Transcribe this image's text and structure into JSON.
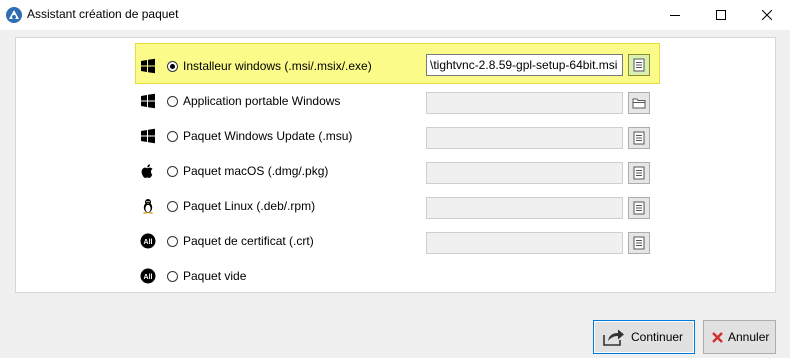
{
  "window": {
    "title": "Assistant création de paquet",
    "icon": "app-logo-icon"
  },
  "options": [
    {
      "icon": "windows-icon",
      "label": "Installeur windows (.msi/.msix/.exe)",
      "checked": true,
      "path": "\\tightvnc-2.8.59-gpl-setup-64bit.msi",
      "browse_icon": "file-icon"
    },
    {
      "icon": "windows-icon",
      "label": "Application portable Windows",
      "checked": false,
      "path": "",
      "browse_icon": "folder-icon"
    },
    {
      "icon": "windows-icon",
      "label": "Paquet Windows Update (.msu)",
      "checked": false,
      "path": "",
      "browse_icon": "file-icon"
    },
    {
      "icon": "apple-icon",
      "label": "Paquet macOS (.dmg/.pkg)",
      "checked": false,
      "path": "",
      "browse_icon": "file-icon"
    },
    {
      "icon": "linux-icon",
      "label": "Paquet Linux (.deb/.rpm)",
      "checked": false,
      "path": "",
      "browse_icon": "file-icon"
    },
    {
      "icon": "all-icon",
      "label": "Paquet de certificat (.crt)",
      "checked": false,
      "path": "",
      "browse_icon": "file-icon"
    },
    {
      "icon": "all-icon",
      "label": "Paquet vide",
      "checked": false
    }
  ],
  "all_badge_text": "All",
  "buttons": {
    "continue": "Continuer",
    "cancel": "Annuler"
  },
  "colors": {
    "highlight": "#fbfb8a",
    "cancel_x": "#d0312d"
  }
}
